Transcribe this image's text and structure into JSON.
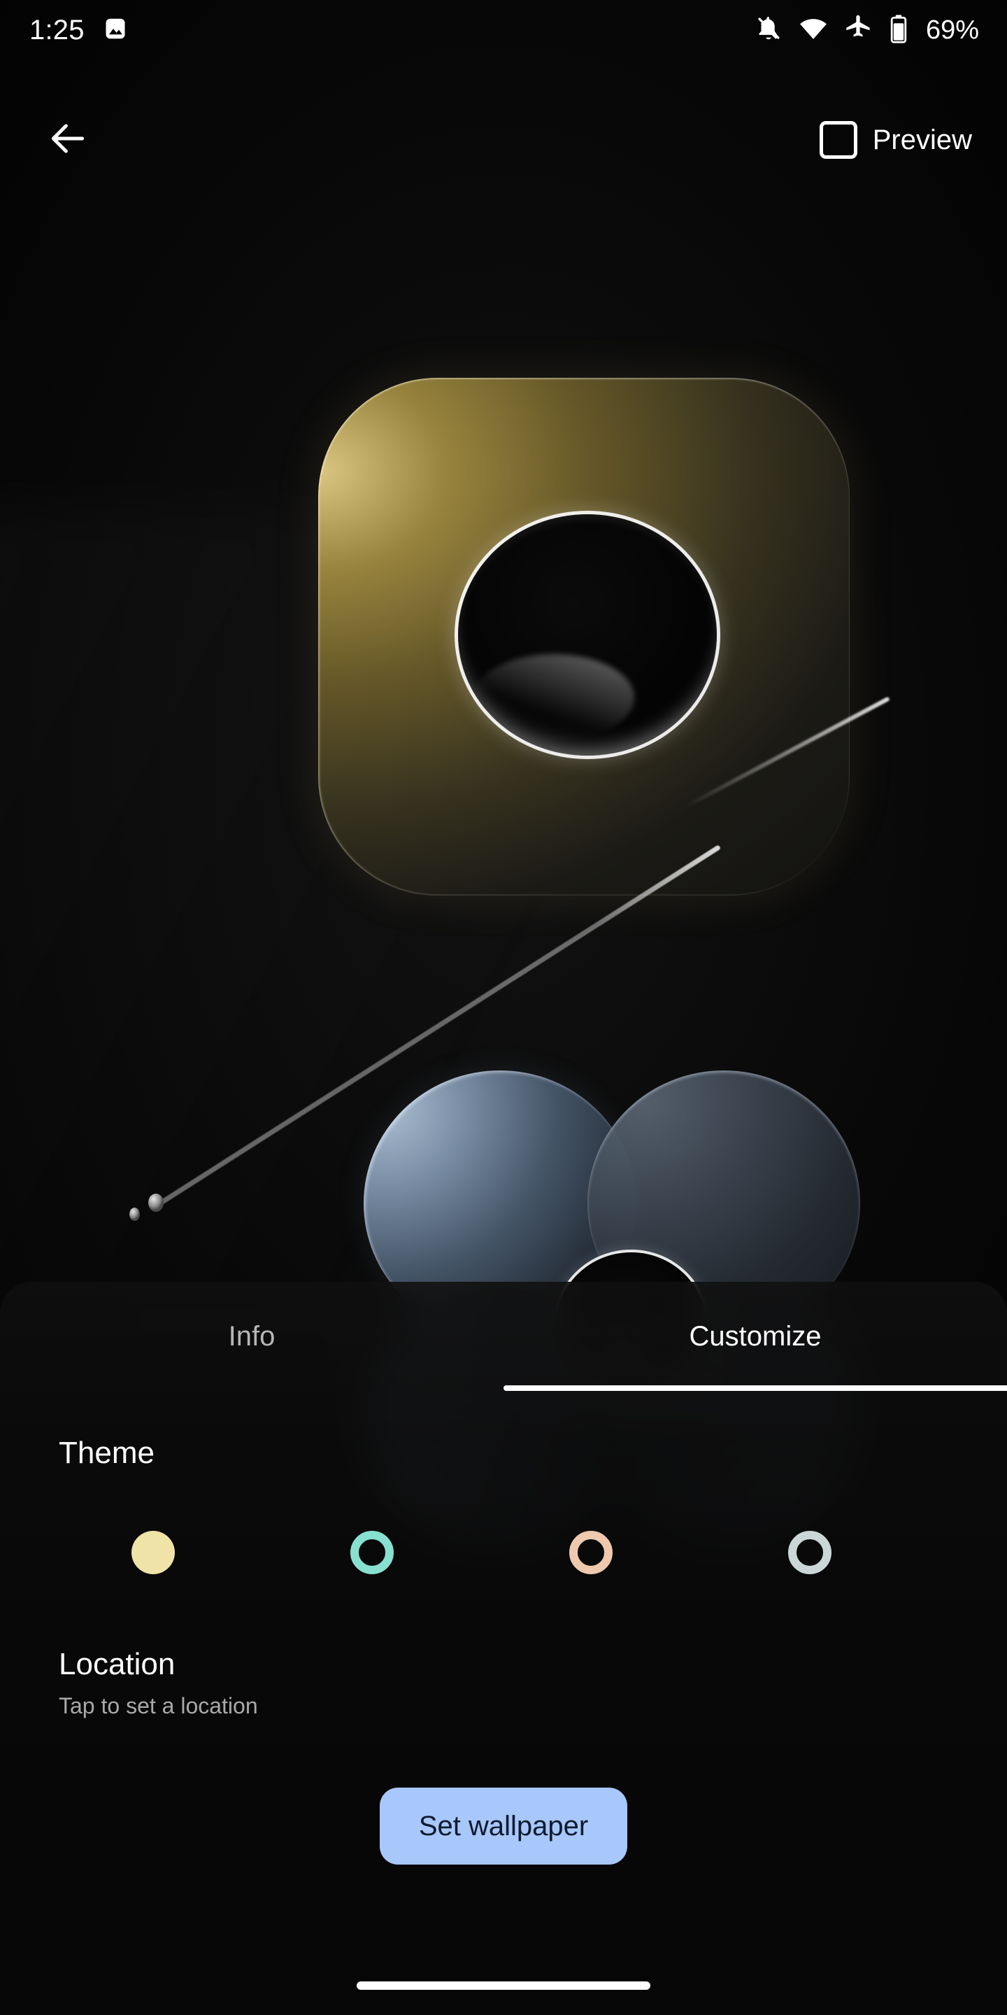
{
  "status_bar": {
    "time": "1:25",
    "left_icons": [
      "image-icon"
    ],
    "right_icons": [
      "notifications-off-icon",
      "wifi-icon",
      "airplane-mode-icon",
      "battery-icon"
    ],
    "battery_percent": "69%"
  },
  "app_bar": {
    "back_icon": "arrow-back-icon",
    "preview_checkbox_icon": "checkbox-unchecked-icon",
    "preview_label": "Preview",
    "preview_checked": false
  },
  "wallpaper_preview": {
    "shapes": [
      "golden-squircle",
      "blue-clover",
      "diagonal-rod"
    ],
    "accent_gold": "#B09846",
    "accent_blue": "#7C96B0"
  },
  "bottom_sheet": {
    "tabs": [
      {
        "label": "Info",
        "active": false
      },
      {
        "label": "Customize",
        "active": true
      }
    ],
    "theme": {
      "title": "Theme",
      "swatches": [
        {
          "name": "yellow",
          "color": "#F0E3A8",
          "selected": true
        },
        {
          "name": "teal",
          "color": "#87E0D0",
          "selected": false
        },
        {
          "name": "peach",
          "color": "#EFC9AD",
          "selected": false
        },
        {
          "name": "blue-grey",
          "color": "#CBD7D6",
          "selected": false
        }
      ]
    },
    "location": {
      "title": "Location",
      "subtitle": "Tap to set a location"
    },
    "primary_action": {
      "label": "Set wallpaper",
      "bg_color": "#A8C7FA",
      "text_color": "#0d1b2e"
    }
  },
  "navigation": {
    "home_indicator": "gesture-home-bar"
  }
}
